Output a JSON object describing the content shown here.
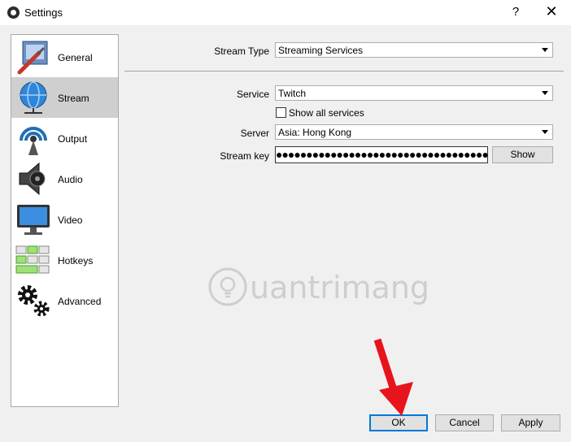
{
  "window": {
    "title": "Settings",
    "help": "?",
    "close": "✕"
  },
  "sidebar": {
    "items": [
      {
        "label": "General",
        "icon": "general-icon"
      },
      {
        "label": "Stream",
        "icon": "stream-icon",
        "selected": true
      },
      {
        "label": "Output",
        "icon": "output-icon"
      },
      {
        "label": "Audio",
        "icon": "audio-icon"
      },
      {
        "label": "Video",
        "icon": "video-icon"
      },
      {
        "label": "Hotkeys",
        "icon": "hotkeys-icon"
      },
      {
        "label": "Advanced",
        "icon": "advanced-icon"
      }
    ]
  },
  "stream": {
    "stream_type_label": "Stream Type",
    "stream_type_value": "Streaming Services",
    "service_label": "Service",
    "service_value": "Twitch",
    "show_all_label": "Show all services",
    "show_all_checked": false,
    "server_label": "Server",
    "server_value": "Asia: Hong Kong",
    "key_label": "Stream key",
    "key_value": "●●●●●●●●●●●●●●●●●●●●●●●●●●●●●●●●●●●●●●●●●●●●●●●●",
    "show_button": "Show"
  },
  "footer": {
    "ok": "OK",
    "cancel": "Cancel",
    "apply": "Apply"
  },
  "watermark": {
    "text": "uantrimang"
  },
  "colors": {
    "selected_item": "#cfcfcf",
    "default_button_border": "#0078d7",
    "annotation_arrow": "#e8141b"
  }
}
